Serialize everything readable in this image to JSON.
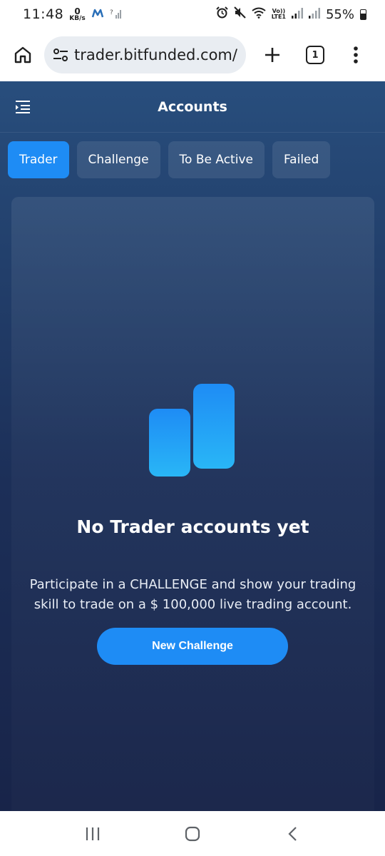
{
  "status_bar": {
    "time": "11:48",
    "data_rate_value": "0",
    "data_rate_unit": "KB/s",
    "network_label_top": "Vo))",
    "network_label_bottom": "LTE1",
    "battery": "55%"
  },
  "browser": {
    "url": "trader.bitfunded.com/",
    "tab_count": "1"
  },
  "app": {
    "title": "Accounts",
    "tabs": [
      {
        "label": "Trader",
        "active": true
      },
      {
        "label": "Challenge",
        "active": false
      },
      {
        "label": "To Be Active",
        "active": false
      },
      {
        "label": "Failed",
        "active": false
      }
    ],
    "empty_state": {
      "title": "No Trader accounts yet",
      "description": "Participate in a CHALLENGE and show your trading skill to trade on a $ 100,000 live trading account.",
      "button_label": "New Challenge"
    }
  },
  "colors": {
    "accent": "#1e8cf5",
    "background_top": "#284e7d",
    "background_bottom": "#182449"
  },
  "icons": {
    "home": "home-icon",
    "site_settings": "tune-icon",
    "new_tab": "plus-icon",
    "tabs": "tabs-icon",
    "more": "more-vert-icon",
    "menu": "menu-icon",
    "illustration": "bar-chart-icon",
    "recents": "recents-icon",
    "home_nav": "home-nav-icon",
    "back": "back-icon"
  }
}
